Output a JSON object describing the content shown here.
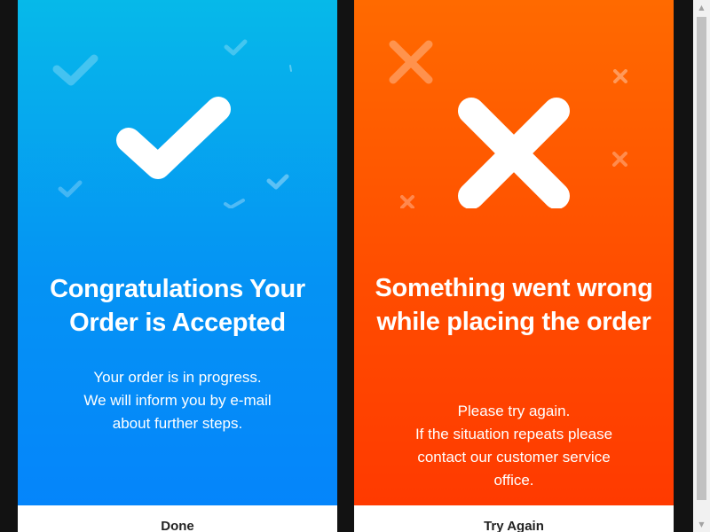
{
  "success_card": {
    "title": "Congratulations Your Order is Accepted",
    "message_lines": [
      "Your order is in progress.",
      "We will inform you by e-mail",
      "about further steps."
    ],
    "button_label": "Done",
    "gradient_colors": [
      "#06b9e9",
      "#0585fb"
    ],
    "main_icon": "checkmark-icon",
    "decor_icon": "small-checkmark-icon"
  },
  "error_card": {
    "title": "Something went wrong while placing the order",
    "message_lines": [
      "Please try again.",
      "If the situation repeats please",
      "contact our customer service",
      "office."
    ],
    "button_label": "Try Again",
    "gradient_colors": [
      "#ff6a00",
      "#ff3a00"
    ],
    "main_icon": "cross-icon",
    "decor_icon": "small-cross-icon"
  },
  "colors": {
    "page_background": "#121212",
    "text_on_card": "#ffffff",
    "button_background": "#ffffff",
    "button_text": "#222222"
  }
}
